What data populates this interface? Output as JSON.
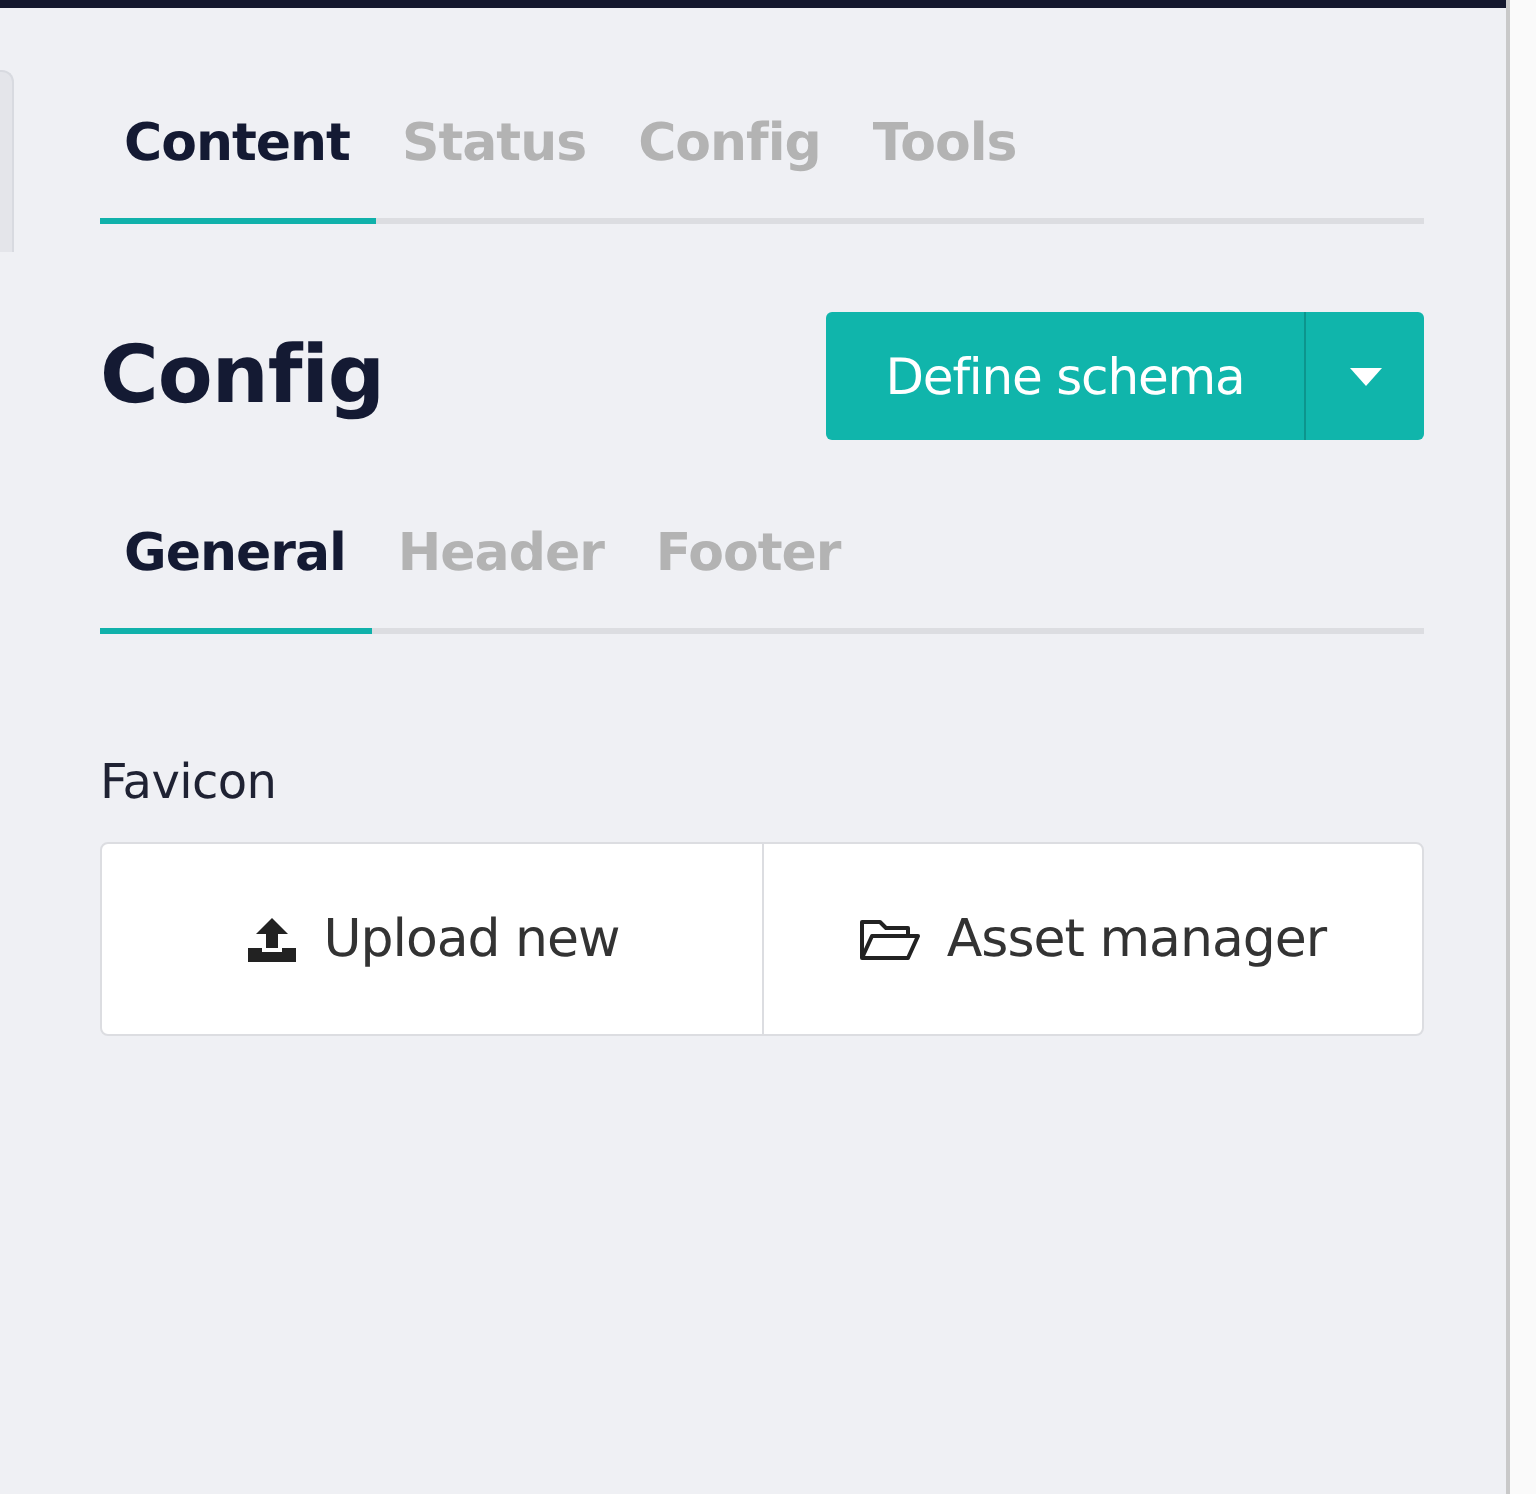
{
  "tabs": [
    {
      "label": "Content",
      "selected": true
    },
    {
      "label": "Status",
      "selected": false
    },
    {
      "label": "Config",
      "selected": false
    },
    {
      "label": "Tools",
      "selected": false
    }
  ],
  "heading": "Config",
  "primary_button": {
    "label": "Define schema"
  },
  "subtabs": [
    {
      "label": "General",
      "selected": true
    },
    {
      "label": "Header",
      "selected": false
    },
    {
      "label": "Footer",
      "selected": false
    }
  ],
  "field": {
    "label": "Favicon",
    "buttons": [
      {
        "label": "Upload new",
        "kind": "upload"
      },
      {
        "label": "Asset manager",
        "kind": "folder"
      }
    ]
  }
}
